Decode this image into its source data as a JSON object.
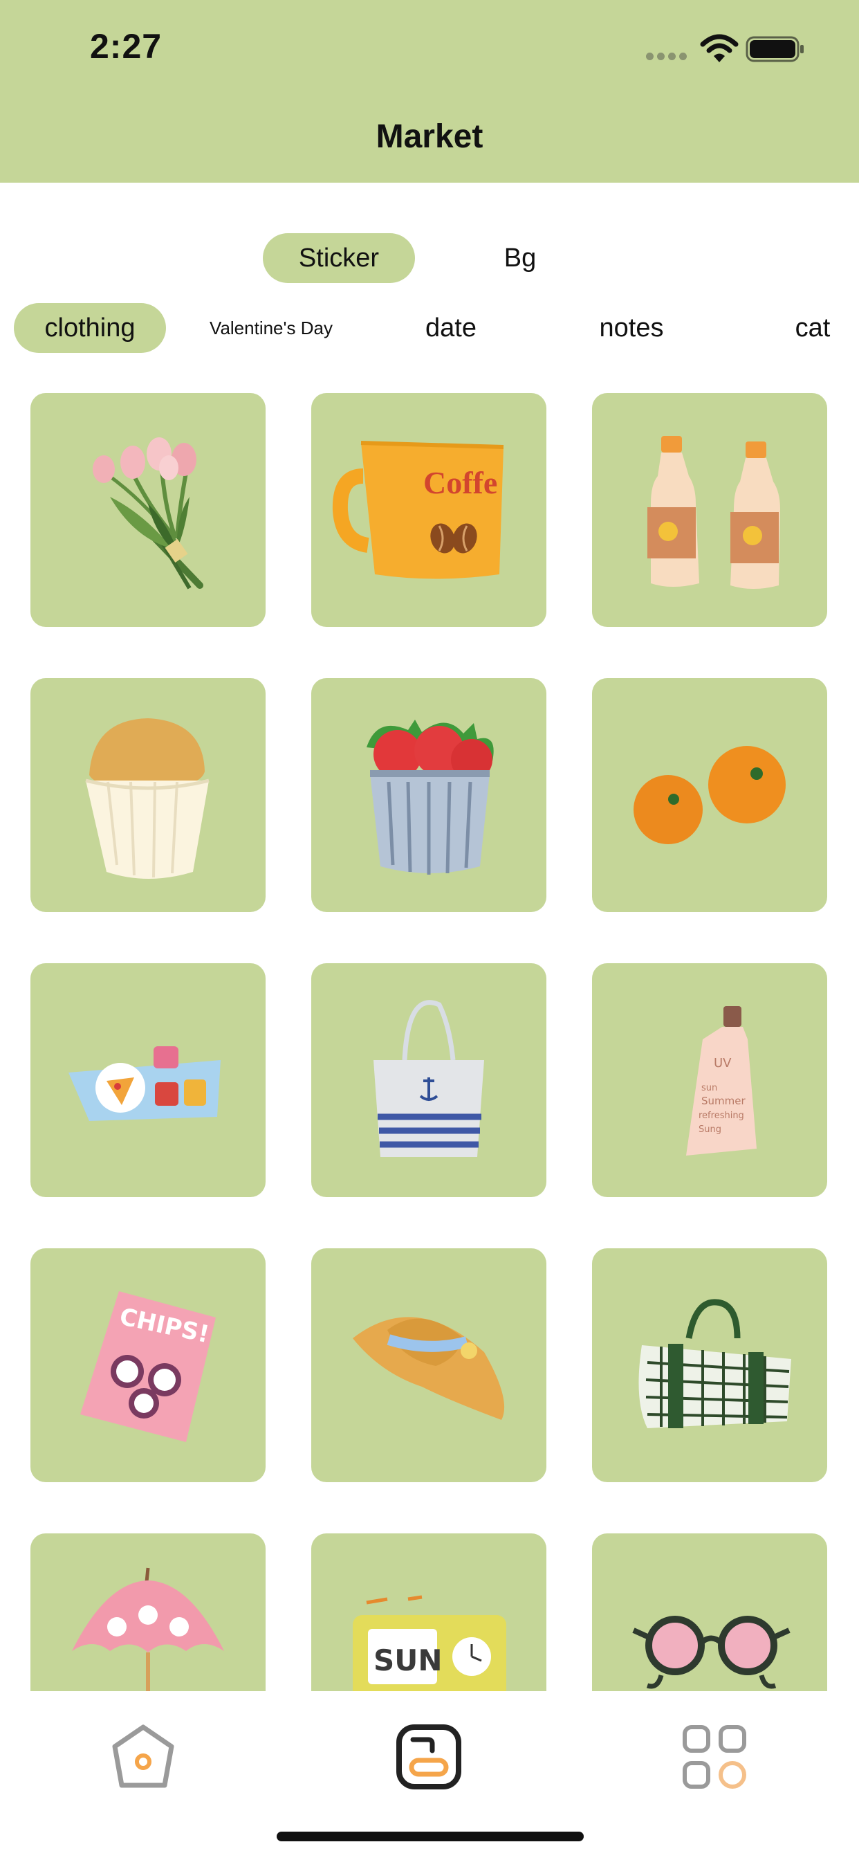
{
  "status_bar": {
    "time": "2:27",
    "icons": [
      "signal-dots-icon",
      "wifi-icon",
      "battery-icon"
    ]
  },
  "header": {
    "title": "Market",
    "background_color": "#c5d698"
  },
  "segments": [
    {
      "label": "Sticker",
      "selected": true
    },
    {
      "label": "Bg",
      "selected": false
    }
  ],
  "categories": [
    {
      "label": "clothing",
      "selected": true
    },
    {
      "label": "Valentine's Day",
      "selected": false
    },
    {
      "label": "date",
      "selected": false
    },
    {
      "label": "notes",
      "selected": false
    },
    {
      "label": "cat",
      "selected": false
    }
  ],
  "stickers": [
    {
      "name": "tulip-bouquet-sticker"
    },
    {
      "name": "coffee-mug-sticker",
      "text": "Coffe"
    },
    {
      "name": "juice-bottles-sticker"
    },
    {
      "name": "muffin-sticker"
    },
    {
      "name": "strawberry-bucket-sticker"
    },
    {
      "name": "oranges-sticker"
    },
    {
      "name": "picnic-blanket-sticker"
    },
    {
      "name": "tote-bag-sticker"
    },
    {
      "name": "sunscreen-tube-sticker",
      "text_lines": [
        "UV",
        "sun",
        "Summer",
        "refreshing",
        "Sung"
      ]
    },
    {
      "name": "chips-bag-sticker",
      "text": "CHIPS!"
    },
    {
      "name": "straw-hat-sticker"
    },
    {
      "name": "picnic-mat-sticker"
    },
    {
      "name": "parasol-sticker"
    },
    {
      "name": "radio-clock-sticker",
      "text": "SUN"
    },
    {
      "name": "sunglasses-sticker"
    }
  ],
  "tab_bar": {
    "items": [
      {
        "name": "home",
        "icon": "home-icon",
        "selected": false
      },
      {
        "name": "market",
        "icon": "market-icon",
        "selected": true
      },
      {
        "name": "apps",
        "icon": "apps-grid-icon",
        "selected": false
      }
    ],
    "accent_color": "#f5a54a"
  }
}
